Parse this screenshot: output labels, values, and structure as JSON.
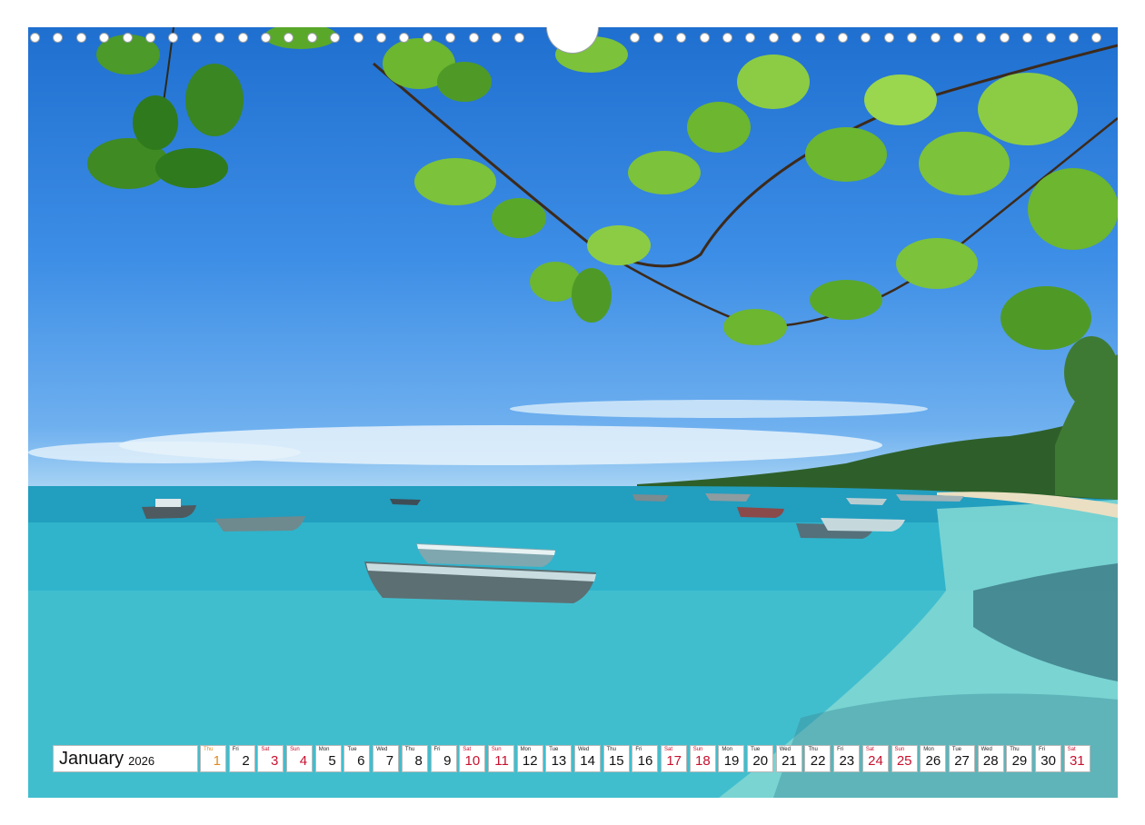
{
  "calendar": {
    "month": "January",
    "year": "2026",
    "days": [
      {
        "wd": "Thu",
        "n": "1",
        "t": "holiday"
      },
      {
        "wd": "Fri",
        "n": "2",
        "t": ""
      },
      {
        "wd": "Sat",
        "n": "3",
        "t": "weekend"
      },
      {
        "wd": "Sun",
        "n": "4",
        "t": "weekend"
      },
      {
        "wd": "Mon",
        "n": "5",
        "t": ""
      },
      {
        "wd": "Tue",
        "n": "6",
        "t": ""
      },
      {
        "wd": "Wed",
        "n": "7",
        "t": ""
      },
      {
        "wd": "Thu",
        "n": "8",
        "t": ""
      },
      {
        "wd": "Fri",
        "n": "9",
        "t": ""
      },
      {
        "wd": "Sat",
        "n": "10",
        "t": "weekend"
      },
      {
        "wd": "Sun",
        "n": "11",
        "t": "weekend"
      },
      {
        "wd": "Mon",
        "n": "12",
        "t": ""
      },
      {
        "wd": "Tue",
        "n": "13",
        "t": ""
      },
      {
        "wd": "Wed",
        "n": "14",
        "t": ""
      },
      {
        "wd": "Thu",
        "n": "15",
        "t": ""
      },
      {
        "wd": "Fri",
        "n": "16",
        "t": ""
      },
      {
        "wd": "Sat",
        "n": "17",
        "t": "weekend"
      },
      {
        "wd": "Sun",
        "n": "18",
        "t": "weekend"
      },
      {
        "wd": "Mon",
        "n": "19",
        "t": ""
      },
      {
        "wd": "Tue",
        "n": "20",
        "t": ""
      },
      {
        "wd": "Wed",
        "n": "21",
        "t": ""
      },
      {
        "wd": "Thu",
        "n": "22",
        "t": ""
      },
      {
        "wd": "Fri",
        "n": "23",
        "t": ""
      },
      {
        "wd": "Sat",
        "n": "24",
        "t": "weekend"
      },
      {
        "wd": "Sun",
        "n": "25",
        "t": "weekend"
      },
      {
        "wd": "Mon",
        "n": "26",
        "t": ""
      },
      {
        "wd": "Tue",
        "n": "27",
        "t": ""
      },
      {
        "wd": "Wed",
        "n": "28",
        "t": ""
      },
      {
        "wd": "Thu",
        "n": "29",
        "t": ""
      },
      {
        "wd": "Fri",
        "n": "30",
        "t": ""
      },
      {
        "wd": "Sat",
        "n": "31",
        "t": "weekend"
      }
    ]
  },
  "photo": {
    "icon": "beach-photo",
    "colors": {
      "sky": "#2f7fd9",
      "sea": "#2ab0c8",
      "leaves": "#5aa82a",
      "weekend": "#c8102e",
      "holiday": "#e08a1e"
    }
  }
}
